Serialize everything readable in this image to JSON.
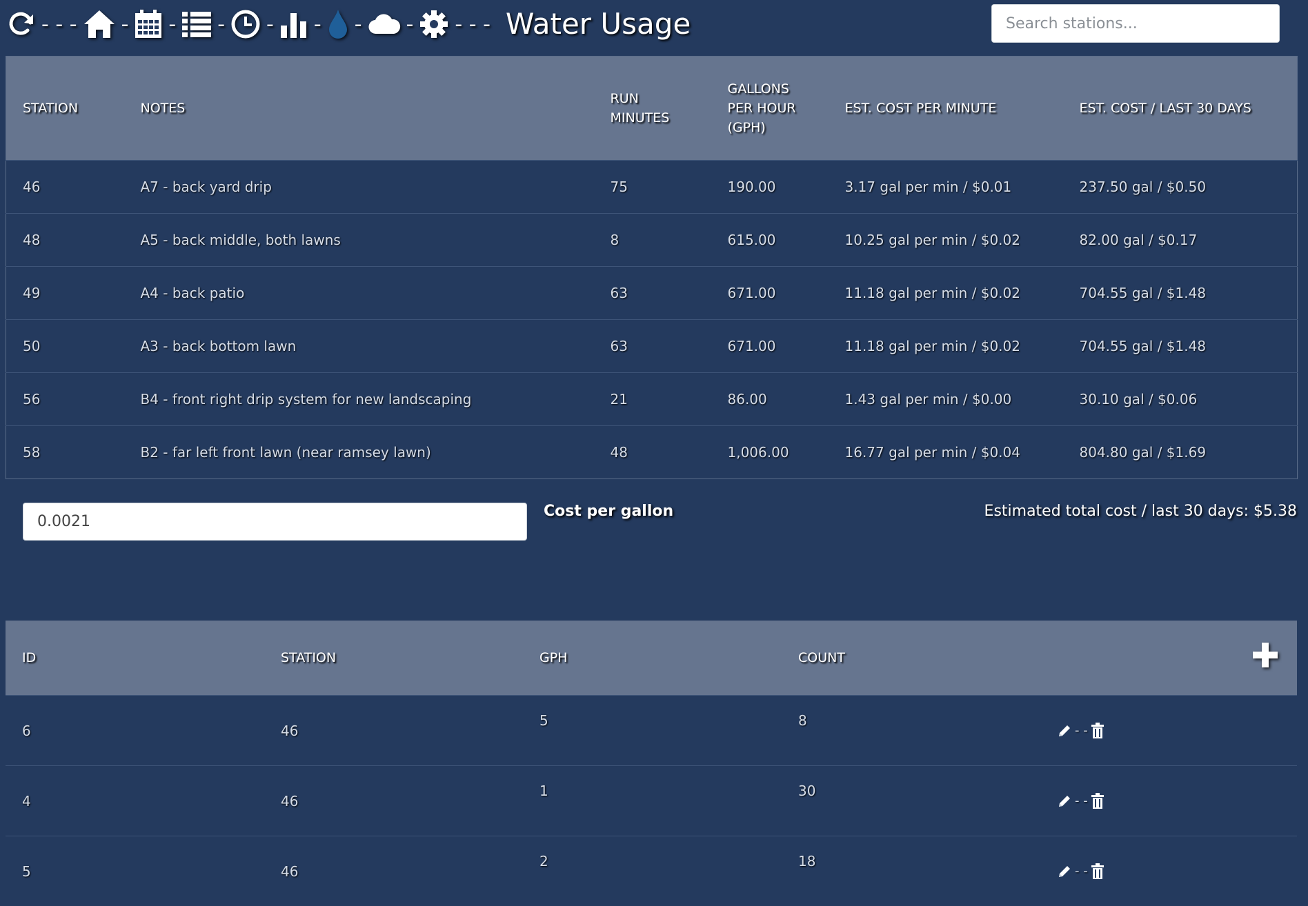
{
  "app": {
    "title": "Water Usage",
    "nav_icons": [
      "refresh-icon",
      "home-icon",
      "calendar-icon",
      "list-icon",
      "clock-icon",
      "bar-chart-icon",
      "water-drop-icon",
      "cloud-icon",
      "gear-icon"
    ],
    "separator": "-",
    "accent_color": "#1f5f99"
  },
  "search": {
    "placeholder": "Search stations..."
  },
  "usage_table": {
    "headers": [
      "STATION",
      "NOTES",
      "RUN MINUTES",
      "GALLONS PER HOUR (GPH)",
      "EST. COST PER MINUTE",
      "EST. COST / LAST 30 DAYS"
    ],
    "rows": [
      [
        "46",
        "A7 - back yard drip",
        "75",
        "190.00",
        "3.17 gal per min / $0.01",
        "237.50 gal / $0.50"
      ],
      [
        "48",
        "A5 - back middle, both lawns",
        "8",
        "615.00",
        "10.25 gal per min / $0.02",
        "82.00 gal / $0.17"
      ],
      [
        "49",
        "A4 - back patio",
        "63",
        "671.00",
        "11.18 gal per min / $0.02",
        "704.55 gal / $1.48"
      ],
      [
        "50",
        "A3 - back bottom lawn",
        "63",
        "671.00",
        "11.18 gal per min / $0.02",
        "704.55 gal / $1.48"
      ],
      [
        "56",
        "B4 - front right drip system for new landscaping",
        "21",
        "86.00",
        "1.43 gal per min / $0.00",
        "30.10 gal / $0.06"
      ],
      [
        "58",
        "B2 - far left front lawn (near ramsey lawn)",
        "48",
        "1,006.00",
        "16.77 gal per min / $0.04",
        "804.80 gal / $1.69"
      ]
    ]
  },
  "cost": {
    "value": "0.0021",
    "label": "Cost per gallon",
    "total_text": "Estimated total cost / last 30 days: $5.38"
  },
  "emitters_table": {
    "headers": [
      "ID",
      "STATION",
      "GPH",
      "COUNT"
    ],
    "add_icon": "plus-icon",
    "row_action_separator": "- -",
    "rows": [
      [
        "6",
        "46",
        "5",
        "8"
      ],
      [
        "4",
        "46",
        "1",
        "30"
      ],
      [
        "5",
        "46",
        "2",
        "18"
      ]
    ]
  }
}
